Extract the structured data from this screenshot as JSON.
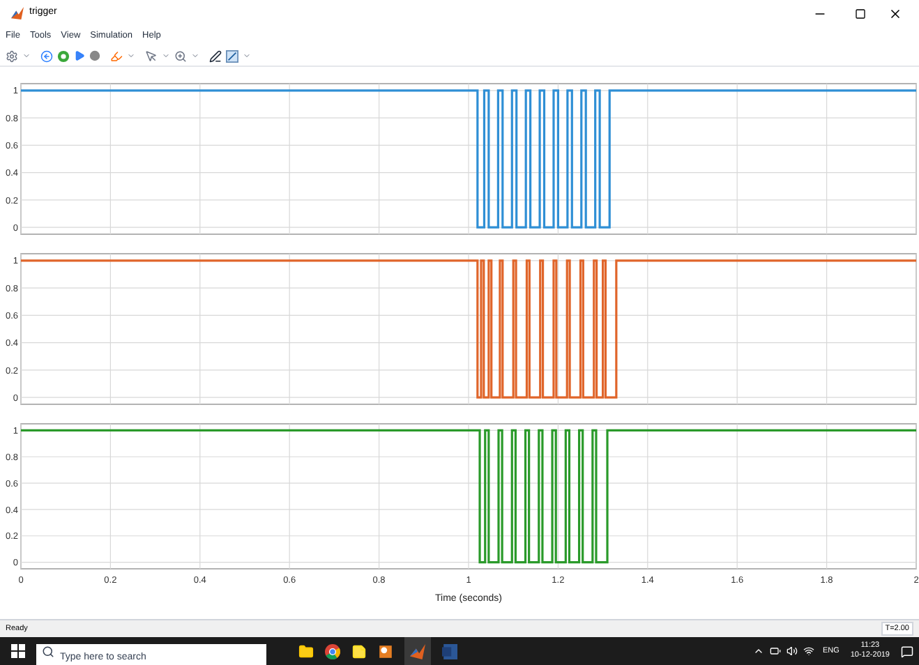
{
  "window": {
    "title": "trigger"
  },
  "menu": [
    "File",
    "Tools",
    "View",
    "Simulation",
    "Help"
  ],
  "plots": [
    {
      "chart_data": {
        "type": "line",
        "grid": true,
        "xlim": [
          0,
          2
        ],
        "ylim": [
          -0.05,
          1.05
        ],
        "yticks": [
          0,
          0.2,
          0.4,
          0.6,
          0.8,
          1
        ],
        "series": [
          {
            "color": "#2f8fd5",
            "x": [
              0,
              1.02,
              1.02,
              1.035,
              1.035,
              1.045,
              1.045,
              1.066,
              1.066,
              1.076,
              1.076,
              1.097,
              1.097,
              1.107,
              1.107,
              1.128,
              1.128,
              1.138,
              1.138,
              1.159,
              1.159,
              1.169,
              1.169,
              1.19,
              1.19,
              1.2,
              1.2,
              1.221,
              1.221,
              1.231,
              1.231,
              1.252,
              1.252,
              1.262,
              1.262,
              1.283,
              1.283,
              1.293,
              1.293,
              1.315,
              1.315,
              2
            ],
            "values": [
              1,
              1,
              0,
              0,
              1,
              1,
              0,
              0,
              1,
              1,
              0,
              0,
              1,
              1,
              0,
              0,
              1,
              1,
              0,
              0,
              1,
              1,
              0,
              0,
              1,
              1,
              0,
              0,
              1,
              1,
              0,
              0,
              1,
              1,
              0,
              0,
              1,
              1,
              0,
              0,
              1,
              1
            ]
          }
        ]
      }
    },
    {
      "chart_data": {
        "type": "line",
        "grid": true,
        "xlim": [
          0,
          2
        ],
        "ylim": [
          -0.05,
          1.05
        ],
        "yticks": [
          0,
          0.2,
          0.4,
          0.6,
          0.8,
          1
        ],
        "series": [
          {
            "color": "#e0652a",
            "x": [
              0,
              1.02,
              1.02,
              1.028,
              1.028,
              1.034,
              1.034,
              1.045,
              1.045,
              1.051,
              1.051,
              1.07,
              1.07,
              1.076,
              1.076,
              1.1,
              1.1,
              1.106,
              1.106,
              1.13,
              1.13,
              1.136,
              1.136,
              1.16,
              1.16,
              1.166,
              1.166,
              1.19,
              1.19,
              1.196,
              1.196,
              1.22,
              1.22,
              1.226,
              1.226,
              1.25,
              1.25,
              1.256,
              1.256,
              1.28,
              1.28,
              1.286,
              1.286,
              1.3,
              1.3,
              1.306,
              1.306,
              1.33,
              1.33,
              2
            ],
            "values": [
              1,
              1,
              0,
              0,
              1,
              1,
              0,
              0,
              1,
              1,
              0,
              0,
              1,
              1,
              0,
              0,
              1,
              1,
              0,
              0,
              1,
              1,
              0,
              0,
              1,
              1,
              0,
              0,
              1,
              1,
              0,
              0,
              1,
              1,
              0,
              0,
              1,
              1,
              0,
              0,
              1,
              1,
              0,
              0,
              1,
              1,
              0,
              0,
              1,
              1
            ]
          }
        ]
      }
    },
    {
      "chart_data": {
        "type": "line",
        "grid": true,
        "xlabel": "Time (seconds)",
        "xlim": [
          0,
          2
        ],
        "ylim": [
          -0.05,
          1.05
        ],
        "xticks": [
          0,
          0.2,
          0.4,
          0.6,
          0.8,
          1,
          1.2,
          1.4,
          1.6,
          1.8,
          2
        ],
        "yticks": [
          0,
          0.2,
          0.4,
          0.6,
          0.8,
          1
        ],
        "series": [
          {
            "color": "#2a9a2a",
            "x": [
              0,
              1.025,
              1.025,
              1.037,
              1.037,
              1.045,
              1.045,
              1.067,
              1.067,
              1.075,
              1.075,
              1.097,
              1.097,
              1.105,
              1.105,
              1.127,
              1.127,
              1.135,
              1.135,
              1.157,
              1.157,
              1.165,
              1.165,
              1.187,
              1.187,
              1.195,
              1.195,
              1.217,
              1.217,
              1.225,
              1.225,
              1.247,
              1.247,
              1.255,
              1.255,
              1.277,
              1.277,
              1.285,
              1.285,
              1.31,
              1.31,
              2
            ],
            "values": [
              1,
              1,
              0,
              0,
              1,
              1,
              0,
              0,
              1,
              1,
              0,
              0,
              1,
              1,
              0,
              0,
              1,
              1,
              0,
              0,
              1,
              1,
              0,
              0,
              1,
              1,
              0,
              0,
              1,
              1,
              0,
              0,
              1,
              1,
              0,
              0,
              1,
              1,
              0,
              0,
              1,
              1
            ]
          }
        ]
      }
    }
  ],
  "status_bar": {
    "status": "Ready",
    "time": "T=2.00"
  },
  "taskbar": {
    "search": {
      "placeholder": "Type here to search"
    },
    "language": "ENG",
    "clock": "11:23",
    "date": "10-12-2019"
  }
}
